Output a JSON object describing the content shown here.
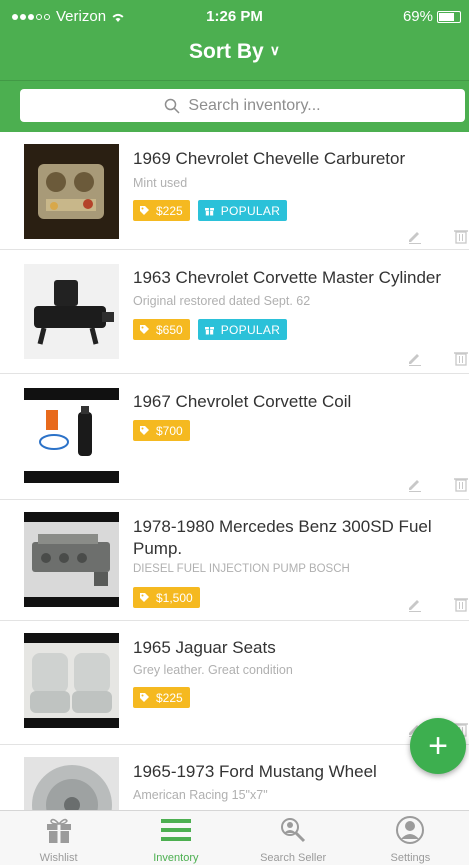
{
  "status_bar": {
    "carrier": "Verizon",
    "time": "1:26 PM",
    "battery": "69%"
  },
  "header": {
    "title": "Sort By"
  },
  "search": {
    "placeholder": "Search inventory..."
  },
  "items": [
    {
      "title": "1969 Chevrolet Chevelle Carburetor",
      "subtitle": "Mint used",
      "price": "$225",
      "badge": "POPULAR"
    },
    {
      "title": "1963 Chevrolet Corvette Master Cylinder",
      "subtitle": "Original restored dated Sept. 62",
      "price": "$650",
      "badge": "POPULAR"
    },
    {
      "title": "1967 Chevrolet Corvette Coil",
      "subtitle": "",
      "price": "$700"
    },
    {
      "title": "1978-1980 Mercedes Benz  300SD Fuel Pump.",
      "subtitle": "DIESEL FUEL INJECTION PUMP BOSCH",
      "price": "$1,500"
    },
    {
      "title": "1965 Jaguar Seats",
      "subtitle": "Grey leather.  Great condition",
      "price": "$225"
    },
    {
      "title": "1965-1973 Ford Mustang Wheel",
      "subtitle": "American Racing 15\"x7\"",
      "price": ""
    }
  ],
  "fab": {
    "label": "+"
  },
  "tabs": [
    {
      "label": "Wishlist",
      "icon": "gift-icon",
      "active": false
    },
    {
      "label": "Inventory",
      "icon": "list-icon",
      "active": true
    },
    {
      "label": "Search Seller",
      "icon": "search-seller-icon",
      "active": false
    },
    {
      "label": "Settings",
      "icon": "user-circle-icon",
      "active": false
    }
  ],
  "colors": {
    "brand_green": "#4caf50",
    "price_badge": "#f5b920",
    "popular_badge": "#2bc1d9"
  }
}
